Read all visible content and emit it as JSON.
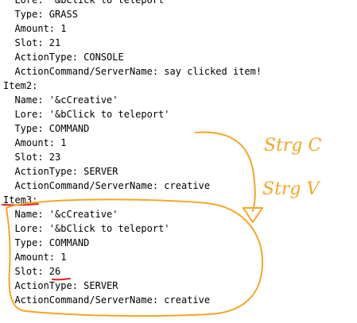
{
  "colors": {
    "text": "#000000",
    "background": "#ffffff",
    "annotation_orange": "#f5a623",
    "annotation_red": "#e02020"
  },
  "lines": [
    "  Lore: '&bClick to teleport'",
    "  Type: GRASS",
    "  Amount: 1",
    "  Slot: 21",
    "  ActionType: CONSOLE",
    "  ActionCommand/ServerName: say clicked item!",
    "Item2:",
    "  Name: '&cCreative'",
    "  Lore: '&bClick to teleport'",
    "  Type: COMMAND",
    "  Amount: 1",
    "  Slot: 23",
    "  ActionType: SERVER",
    "  ActionCommand/ServerName: creative",
    "Item3:",
    "  Name: '&cCreative'",
    "  Lore: '&bClick to teleport'",
    "  Type: COMMAND",
    "  Amount: 1",
    "  Slot: 26",
    "  ActionType: SERVER",
    "  ActionCommand/ServerName: creative"
  ],
  "annotations": {
    "note_copy": "Strg C",
    "note_paste": "Strg V"
  }
}
